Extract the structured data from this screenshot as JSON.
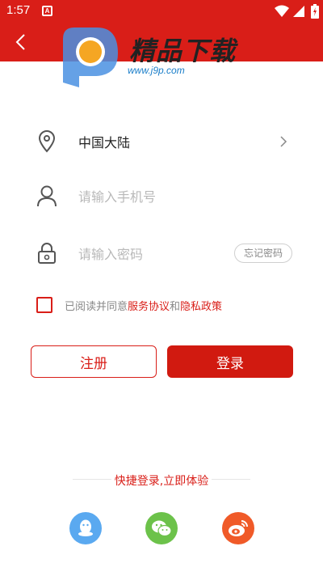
{
  "status_bar": {
    "time": "1:57",
    "notification_icon": "A"
  },
  "header": {
    "back_icon": "chevron-left-icon"
  },
  "watermark": {
    "title": "精品下载",
    "url": "www.j9p.com"
  },
  "form": {
    "region_value": "中国大陆",
    "phone_placeholder": "请输入手机号",
    "password_placeholder": "请输入密码",
    "forgot_password_label": "忘记密码"
  },
  "agreement": {
    "prefix": "已阅读并同意 ",
    "service_link": "服务协议",
    "conjunction": "和",
    "privacy_link": "隐私政策"
  },
  "buttons": {
    "register_label": "注册",
    "login_label": "登录"
  },
  "quick_login": {
    "label": "快捷登录,立即体验",
    "providers": [
      "qq-icon",
      "wechat-icon",
      "weibo-icon"
    ]
  },
  "colors": {
    "brand_red": "#d91e18",
    "qq_blue": "#5aa9f0",
    "wechat_green": "#6cc24a",
    "weibo_orange": "#f05a28"
  }
}
